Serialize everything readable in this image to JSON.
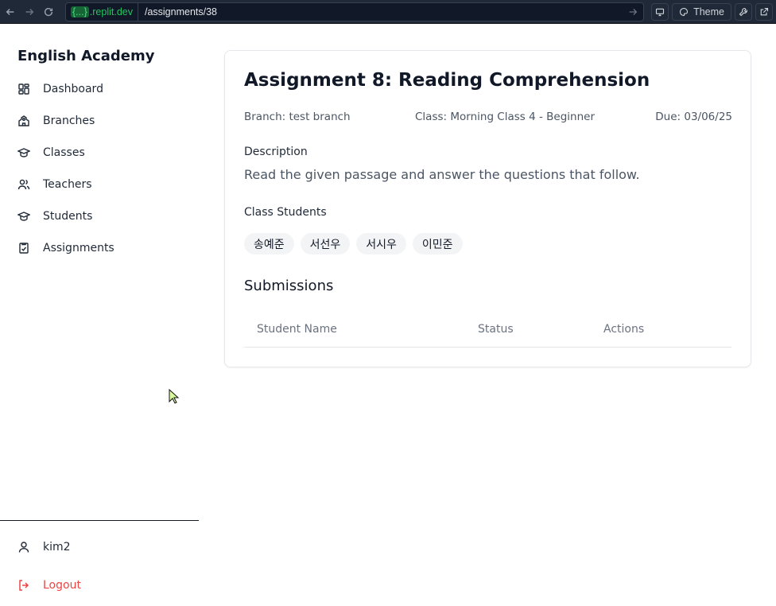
{
  "browser": {
    "url_domain_braces": "{...}",
    "url_domain_suffix": ".replit.dev",
    "url_path": "/assignments/38",
    "theme_label": "Theme"
  },
  "sidebar": {
    "brand": "English Academy",
    "items": [
      {
        "label": "Dashboard",
        "icon": "dashboard-grid-icon"
      },
      {
        "label": "Branches",
        "icon": "school-building-icon"
      },
      {
        "label": "Classes",
        "icon": "graduation-cap-icon"
      },
      {
        "label": "Teachers",
        "icon": "users-icon"
      },
      {
        "label": "Students",
        "icon": "graduation-cap-icon"
      },
      {
        "label": "Assignments",
        "icon": "clipboard-check-icon"
      }
    ],
    "user": "kim2",
    "logout": "Logout"
  },
  "assignment": {
    "title": "Assignment 8: Reading Comprehension",
    "branch": "Branch: test branch",
    "class": "Class: Morning Class 4 - Beginner",
    "due": "Due: 03/06/25",
    "description_label": "Description",
    "description": "Read the given passage and answer the questions that follow.",
    "students_label": "Class Students",
    "students": [
      "송예준",
      "서선우",
      "서시우",
      "이민준"
    ]
  },
  "submissions": {
    "title": "Submissions",
    "columns": [
      "Student Name",
      "Status",
      "Actions"
    ],
    "rows": []
  },
  "colors": {
    "accent_danger": "#ef4444",
    "text_primary": "#111827",
    "text_muted": "#4b5563"
  }
}
